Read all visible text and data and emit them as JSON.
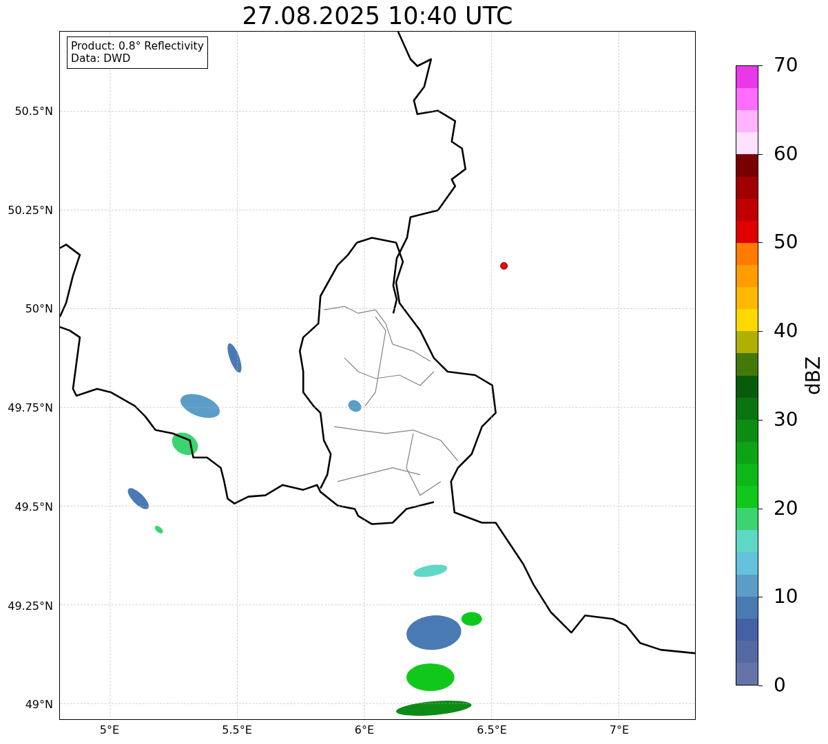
{
  "title": "27.08.2025 10:40 UTC",
  "map": {
    "info_box": [
      "Product: 0.8° Reflectivity",
      "Data: DWD"
    ],
    "x_ticks": [
      "5°E",
      "5.5°E",
      "6°E",
      "6.5°E",
      "7°E"
    ],
    "y_ticks": [
      "50.5°N",
      "50.25°N",
      "50°N",
      "49.75°N",
      "49.5°N",
      "49.25°N",
      "49°N"
    ]
  },
  "colorbar": {
    "label": "dBZ",
    "ticks": [
      "70",
      "60",
      "50",
      "40",
      "30",
      "20",
      "10",
      "0"
    ],
    "bins": [
      {
        "color": "#e838e8"
      },
      {
        "color": "#ff6cff"
      },
      {
        "color": "#ffb4ff"
      },
      {
        "color": "#ffe0ff"
      },
      {
        "color": "#780000"
      },
      {
        "color": "#a00000"
      },
      {
        "color": "#c00000"
      },
      {
        "color": "#e00000"
      },
      {
        "color": "#ff7c00"
      },
      {
        "color": "#ff9c00"
      },
      {
        "color": "#ffb800"
      },
      {
        "color": "#ffd800"
      },
      {
        "color": "#b0b004"
      },
      {
        "color": "#447808"
      },
      {
        "color": "#065c0a"
      },
      {
        "color": "#0a7410"
      },
      {
        "color": "#0c8c14"
      },
      {
        "color": "#0ca414"
      },
      {
        "color": "#0cb818"
      },
      {
        "color": "#10c81c"
      },
      {
        "color": "#3cd470"
      },
      {
        "color": "#5ed8c4"
      },
      {
        "color": "#64c2dc"
      },
      {
        "color": "#5a9ec8"
      },
      {
        "color": "#4a7ab4"
      },
      {
        "color": "#4560a4"
      },
      {
        "color": "#5468a4"
      },
      {
        "color": "#6574a8"
      }
    ]
  }
}
